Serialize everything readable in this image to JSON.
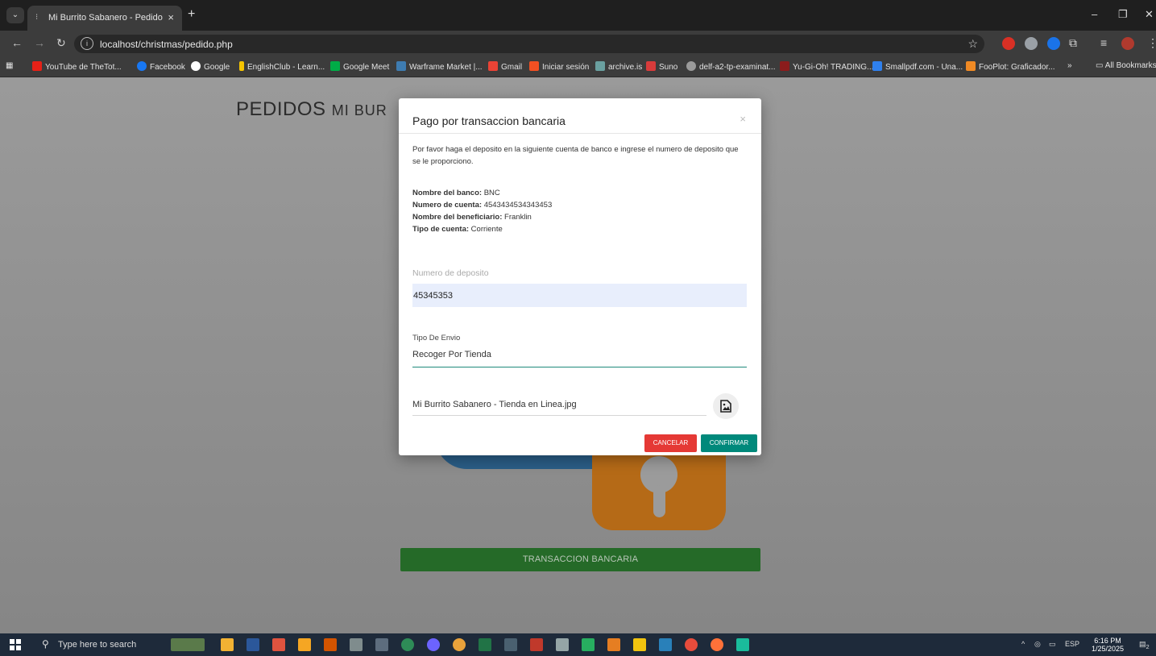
{
  "browser": {
    "tab_menu_icon": "⌄",
    "tab_favicon": "⁝",
    "tab_title": "Mi Burrito Sabanero - Pedido",
    "tab_close": "×",
    "new_tab": "+",
    "url": "localhost/christmas/pedido.php",
    "bookmarks": [
      {
        "label": "YouTube de TheTot...",
        "color": "#e62117"
      },
      {
        "label": "Facebook",
        "color": "#1877f2"
      },
      {
        "label": "Google",
        "color": "#ffffff"
      },
      {
        "label": "EnglishClub - Learn...",
        "color": "#f5c400"
      },
      {
        "label": "Google Meet",
        "color": "#00ac47"
      },
      {
        "label": "Warframe Market |...",
        "color": "#3e7cb1"
      },
      {
        "label": "Gmail",
        "color": "#ea4335"
      },
      {
        "label": "Iniciar sesión",
        "color": "#f25022"
      },
      {
        "label": "archive.is",
        "color": "#6aa0a0"
      },
      {
        "label": "Suno",
        "color": "#d83b3b"
      },
      {
        "label": "delf-a2-tp-examinat...",
        "color": "#9a9a9a"
      },
      {
        "label": "Yu-Gi-Oh! TRADING...",
        "color": "#8b1c1c"
      },
      {
        "label": "Smallpdf.com - Una...",
        "color": "#2f80ed"
      },
      {
        "label": "FooPlot: Graficador...",
        "color": "#f08a24"
      }
    ],
    "bookmarks_overflow": "»",
    "all_bookmarks": "All Bookmarks"
  },
  "page": {
    "heading": "PEDIDOS",
    "heading_sub": "MI BUR",
    "bank_button": "TRANSACCION BANCARIA"
  },
  "modal": {
    "title": "Pago por transaccion bancaria",
    "close": "×",
    "description": "Por favor haga el deposito en la siguiente cuenta de banco e ingrese el numero de deposito que se le proporciono.",
    "bank_name_label": "Nombre del banco:",
    "bank_name": "BNC",
    "account_number_label": "Numero de cuenta:",
    "account_number": "4543434534343453",
    "beneficiary_label": "Nombre del beneficiario:",
    "beneficiary": "Franklin",
    "account_type_label": "Tipo de cuenta:",
    "account_type": "Corriente",
    "deposit_label": "Numero de deposito",
    "deposit_value": "45345353",
    "shipping_label": "Tipo De Envio",
    "shipping_value": "Recoger Por Tienda",
    "file_name": "Mi Burrito Sabanero - Tienda en Linea.jpg",
    "cancel": "CANCELAR",
    "confirm": "CONFIRMAR"
  },
  "taskbar": {
    "search_placeholder": "Type here to search",
    "language": "ESP",
    "time": "6:16 PM",
    "date": "1/25/2025",
    "notifications": "2"
  }
}
